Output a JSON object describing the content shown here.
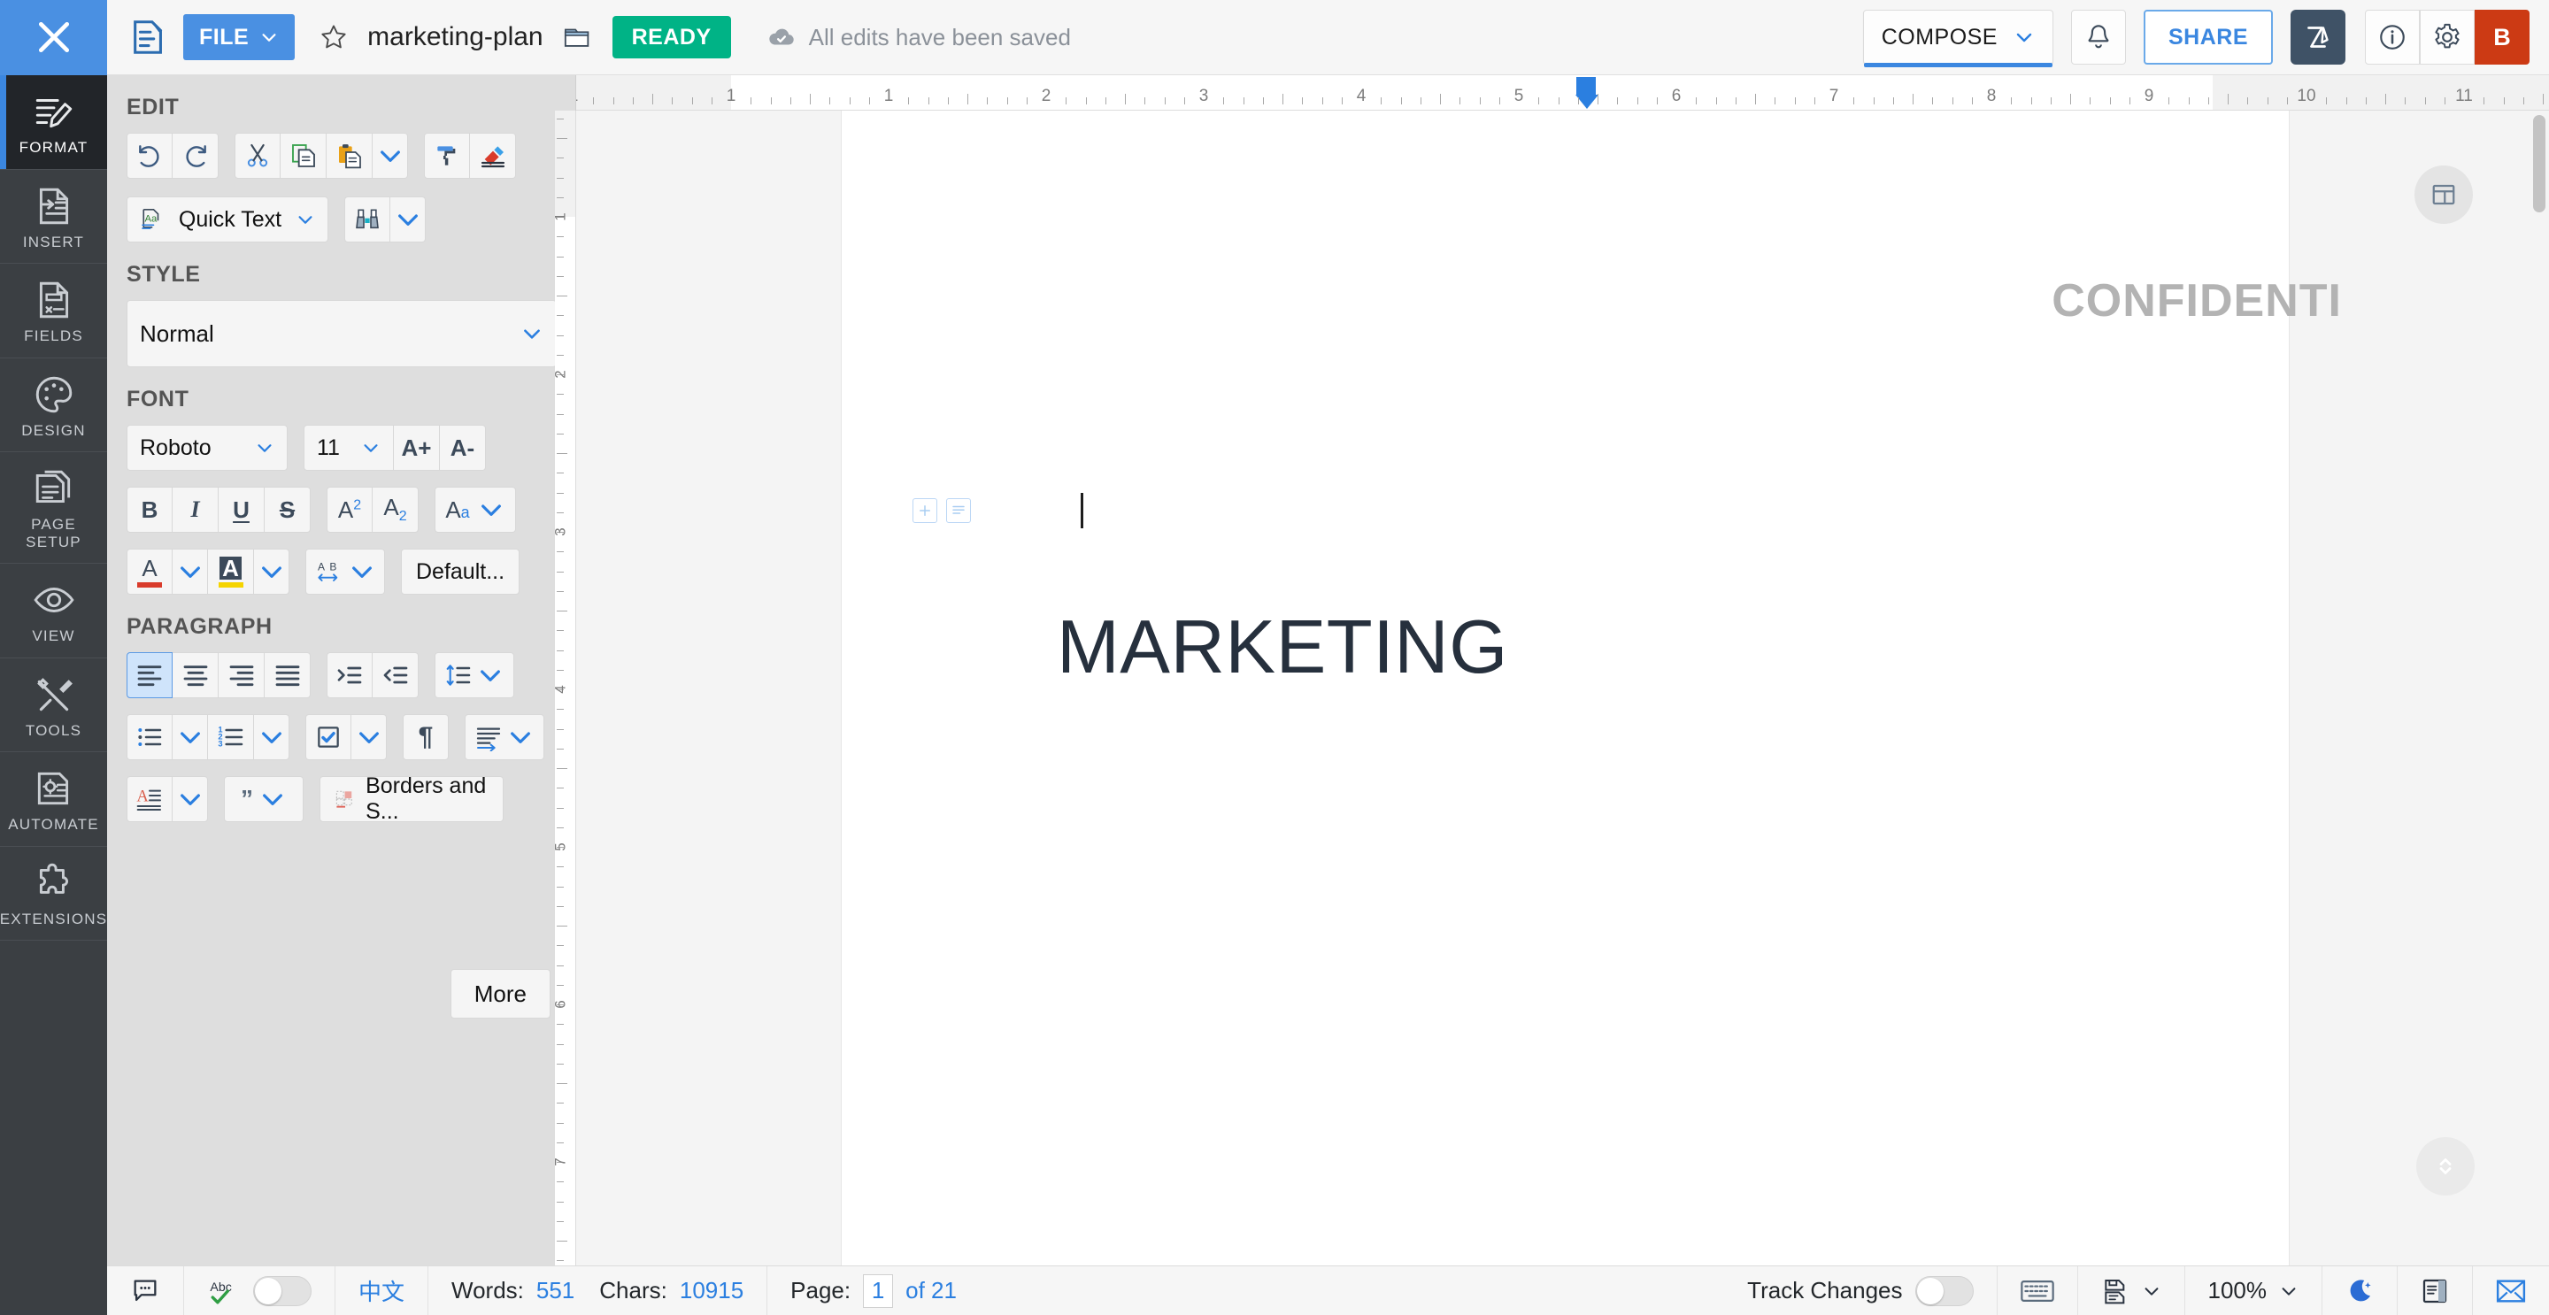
{
  "topbar": {
    "close_icon": "close-icon",
    "doc_icon": "document-edit-icon",
    "file_label": "FILE",
    "star_icon": "favorite-star-icon",
    "doc_title": "marketing-plan",
    "folder_icon": "folder-icon",
    "status_badge": "READY",
    "save_state": "All edits have been saved",
    "save_icon": "cloud-check-icon",
    "compose_label": "COMPOSE",
    "bell_icon": "notification-bell-icon",
    "share_label": "SHARE",
    "app_icon": "zoho-writer-icon",
    "info_icon": "info-icon",
    "settings_icon": "gear-icon",
    "avatar_label": "B"
  },
  "rail": {
    "items": [
      {
        "label": "FORMAT",
        "icon": "format-brush-icon",
        "active": true
      },
      {
        "label": "INSERT",
        "icon": "insert-document-icon",
        "active": false
      },
      {
        "label": "FIELDS",
        "icon": "fields-document-icon",
        "active": false
      },
      {
        "label": "DESIGN",
        "icon": "design-palette-icon",
        "active": false
      },
      {
        "label": "PAGE\nSETUP",
        "icon": "page-setup-icon",
        "active": false
      },
      {
        "label": "VIEW",
        "icon": "eye-icon",
        "active": false
      },
      {
        "label": "TOOLS",
        "icon": "tools-wrench-icon",
        "active": false
      },
      {
        "label": "AUTOMATE",
        "icon": "automate-gear-doc-icon",
        "active": false
      },
      {
        "label": "EXTENSIONS",
        "icon": "puzzle-piece-icon",
        "active": false
      }
    ]
  },
  "panel": {
    "edit": {
      "title": "EDIT",
      "undo_icon": "undo-icon",
      "redo_icon": "redo-icon",
      "cut_icon": "scissors-icon",
      "copy_icon": "copy-icon",
      "paste_icon": "paste-icon",
      "paste_more_icon": "chevron-down-icon",
      "format_painter_icon": "format-painter-icon",
      "clear_format_icon": "clear-formatting-eraser-icon",
      "quick_text_label": "Quick Text",
      "quick_text_icon": "quick-text-icon",
      "find_icon": "find-binoculars-icon"
    },
    "style": {
      "title": "STYLE",
      "value": "Normal"
    },
    "font": {
      "title": "FONT",
      "family": "Roboto",
      "size": "11",
      "grow_label": "A+",
      "shrink_label": "A-",
      "bold_label": "B",
      "italic_label": "I",
      "underline_label": "U",
      "strike_label": "S",
      "superscript_label": "A2",
      "subscript_label": "A2",
      "change_case_label": "Aa",
      "text_color_label": "A",
      "highlight_label": "A",
      "spacing_label": "AB",
      "default_label": "Default..."
    },
    "paragraph": {
      "title": "PARAGRAPH",
      "align_left_icon": "align-left-icon",
      "align_center_icon": "align-center-icon",
      "align_right_icon": "align-right-icon",
      "align_justify_icon": "align-justify-icon",
      "indent_increase_icon": "indent-increase-icon",
      "indent_decrease_icon": "indent-decrease-icon",
      "line_spacing_icon": "line-spacing-icon",
      "bullet_list_icon": "bullet-list-icon",
      "numbered_list_icon": "numbered-list-icon",
      "checklist_icon": "checklist-icon",
      "pilcrow_icon": "pilcrow-icon",
      "text_direction_icon": "text-direction-icon",
      "drop_cap_icon": "drop-cap-icon",
      "quote_icon": "blockquote-icon",
      "borders_label": "Borders and S...",
      "borders_icon": "borders-shading-icon"
    },
    "more_label": "More"
  },
  "ruler": {
    "h_numbers": [
      "1",
      "1",
      "2",
      "3",
      "4",
      "5",
      "6",
      "7"
    ],
    "v_numbers": [
      "1",
      "2",
      "3",
      "4",
      "5"
    ]
  },
  "document": {
    "header_text": "CONFIDENTI",
    "title": "MARKETING",
    "add_block_icon": "add-block-icon",
    "paragraph_settings_icon": "paragraph-settings-icon"
  },
  "overlay": {
    "panel_toggle_icon": "layout-panel-icon",
    "nav_updown_icon": "navigate-up-down-icon"
  },
  "statusbar": {
    "comment_icon": "comment-icon",
    "spellcheck_icon": "spellcheck-abc-icon",
    "spellcheck_on": false,
    "language": "中文",
    "words_label": "Words:",
    "words_value": "551",
    "chars_label": "Chars:",
    "chars_value": "10915",
    "page_label": "Page:",
    "page_current": "1",
    "page_of": "of 21",
    "track_changes_label": "Track Changes",
    "track_changes_on": false,
    "keyboard_icon": "keyboard-icon",
    "save_version_icon": "save-document-icon",
    "zoom_value": "100%",
    "dark_mode_icon": "moon-icon",
    "sidebar_icon": "right-sidebar-icon",
    "mail_icon": "envelope-icon"
  },
  "colors": {
    "accent_blue": "#4a90e2",
    "ready_green": "#00b386",
    "avatar_red": "#cc3a14",
    "rail_dark": "#3b3f43",
    "panel_gray": "#dedede"
  }
}
